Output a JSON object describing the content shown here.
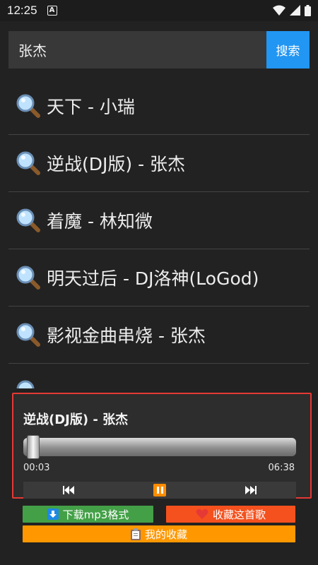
{
  "status_bar": {
    "time": "12:25",
    "a_icon": "A"
  },
  "search": {
    "query": "张杰",
    "button_label": "搜索"
  },
  "results": [
    {
      "label": "天下 - 小瑞"
    },
    {
      "label": "逆战(DJ版) - 张杰"
    },
    {
      "label": "着魔 - 林知微"
    },
    {
      "label": "明天过后 - DJ洛神(LoGod)"
    },
    {
      "label": "影视金曲串烧 - 张杰"
    },
    {
      "label": ""
    }
  ],
  "player": {
    "title": "逆战(DJ版) - 张杰",
    "current_time": "00:03",
    "total_time": "06:38",
    "progress": 0.008
  },
  "actions": {
    "download_label": "下载mp3格式",
    "collect_label": "收藏这首歌",
    "favorites_label": "我的收藏"
  },
  "colors": {
    "search_button": "#2196f3",
    "player_border": "#e53935",
    "download": "#43a047",
    "collect": "#f4511e",
    "favorites": "#ff9800"
  }
}
